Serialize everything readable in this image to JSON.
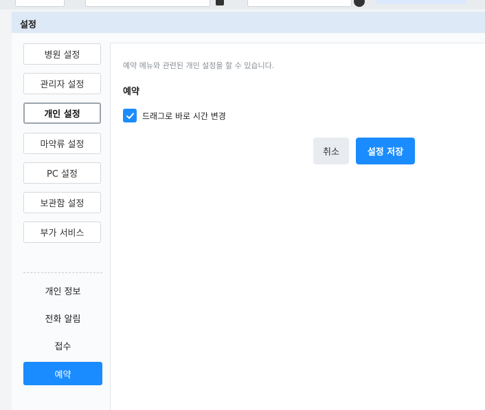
{
  "modal": {
    "title": "설정"
  },
  "sidebar": {
    "buttons": [
      {
        "label": "병원 설정"
      },
      {
        "label": "관리자 설정"
      },
      {
        "label": "개인 설정"
      },
      {
        "label": "마약류 설정"
      },
      {
        "label": "PC 설정"
      },
      {
        "label": "보관함 설정"
      },
      {
        "label": "부가 서비스"
      }
    ],
    "active_button": "개인 설정",
    "links": [
      {
        "label": "개인 정보"
      },
      {
        "label": "전화 알림"
      },
      {
        "label": "접수"
      },
      {
        "label": "예약"
      }
    ],
    "selected_link": "예약"
  },
  "content": {
    "description": "예약 메뉴와 관련된 개인 설정을 할 수 있습니다.",
    "section_title": "예약",
    "checkbox": {
      "label": "드래그로 바로 시간 변경",
      "checked": true
    },
    "cancel_label": "취소",
    "save_label": "설정 저장"
  },
  "colors": {
    "accent": "#1a8cff",
    "header_bg": "#dde9f6",
    "content_bg": "#ffffff"
  },
  "icons": [
    "checkmark-icon"
  ]
}
